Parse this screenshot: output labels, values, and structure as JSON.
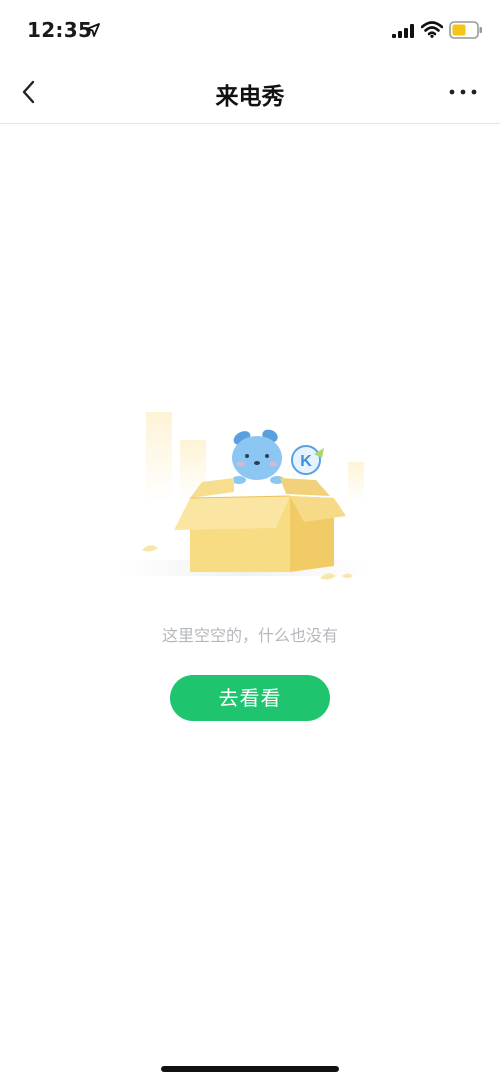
{
  "status_bar": {
    "time": "12:35"
  },
  "header": {
    "title": "来电秀",
    "back_icon": "chevron-left-icon",
    "more_icon": "more-horizontal-icon"
  },
  "empty_state": {
    "message": "这里空空的，什么也没有",
    "button_label": "去看看",
    "illustration_badge": "K"
  },
  "colors": {
    "accent": "#1fc56e",
    "battery": "#f5c518",
    "muted_text": "#b4b8bd"
  }
}
